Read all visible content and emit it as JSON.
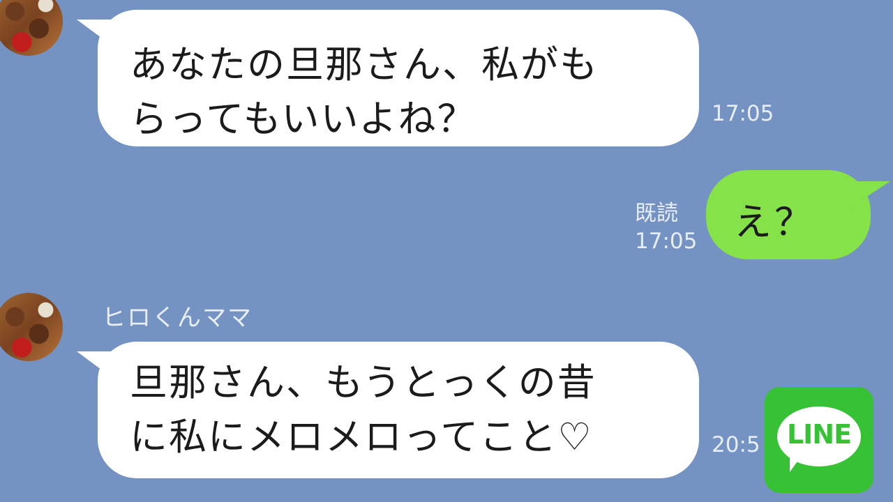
{
  "chat": {
    "messages": [
      {
        "side": "left",
        "text": [
          "あなたの旦那さん、私がも",
          "らってもいいよね？"
        ],
        "time": "17:05"
      },
      {
        "side": "right",
        "text": "え？",
        "read": "既読",
        "time": "17:05"
      },
      {
        "side": "left",
        "sender": "ヒロくんママ",
        "text": [
          "旦那さん、もうとっくの昔",
          "に私にメロメロってこと♡"
        ],
        "time": "20:5"
      }
    ]
  },
  "logo": {
    "word": "LINE",
    "color": "#37c236"
  },
  "colors": {
    "background": "#7493c2",
    "incoming_bubble": "#ffffff",
    "outgoing_bubble": "#85e249"
  },
  "icons": [
    "avatar-image",
    "line-logo-icon"
  ]
}
